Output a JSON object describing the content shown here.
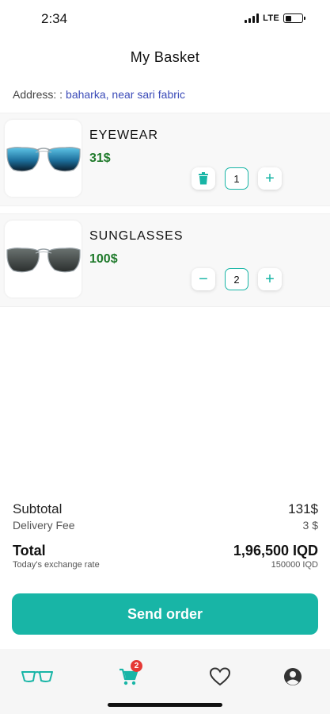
{
  "status_bar": {
    "time": "2:34",
    "network": "LTE"
  },
  "header": {
    "title": "My Basket"
  },
  "address": {
    "label": "Address: :",
    "value": "baharka, near sari fabric"
  },
  "cart": {
    "items": [
      {
        "name": "EYEWEAR",
        "price": "31$",
        "quantity": "1",
        "lens_color": "#1d6f9c",
        "left_action_icon": "trash-icon",
        "right_action_label": "+"
      },
      {
        "name": "SUNGLASSES",
        "price": "100$",
        "quantity": "2",
        "lens_color": "#3a3f3e",
        "left_action_label": "−",
        "right_action_label": "+"
      }
    ]
  },
  "summary": {
    "subtotal_label": "Subtotal",
    "subtotal_value": "131$",
    "fee_label": "Delivery Fee",
    "fee_value": "3 $",
    "total_label": "Total",
    "total_value": "1,96,500 IQD",
    "rate_label": "Today's exchange rate",
    "rate_value": "150000 IQD"
  },
  "actions": {
    "send_label": "Send order"
  },
  "tab_bar": {
    "cart_badge": "2",
    "tabs": [
      "glasses-icon",
      "cart-icon",
      "heart-icon",
      "profile-icon"
    ]
  },
  "colors": {
    "accent": "#18b5a6",
    "price": "#1f7a2b",
    "address_link": "#3b4bb8",
    "badge": "#e53935"
  }
}
